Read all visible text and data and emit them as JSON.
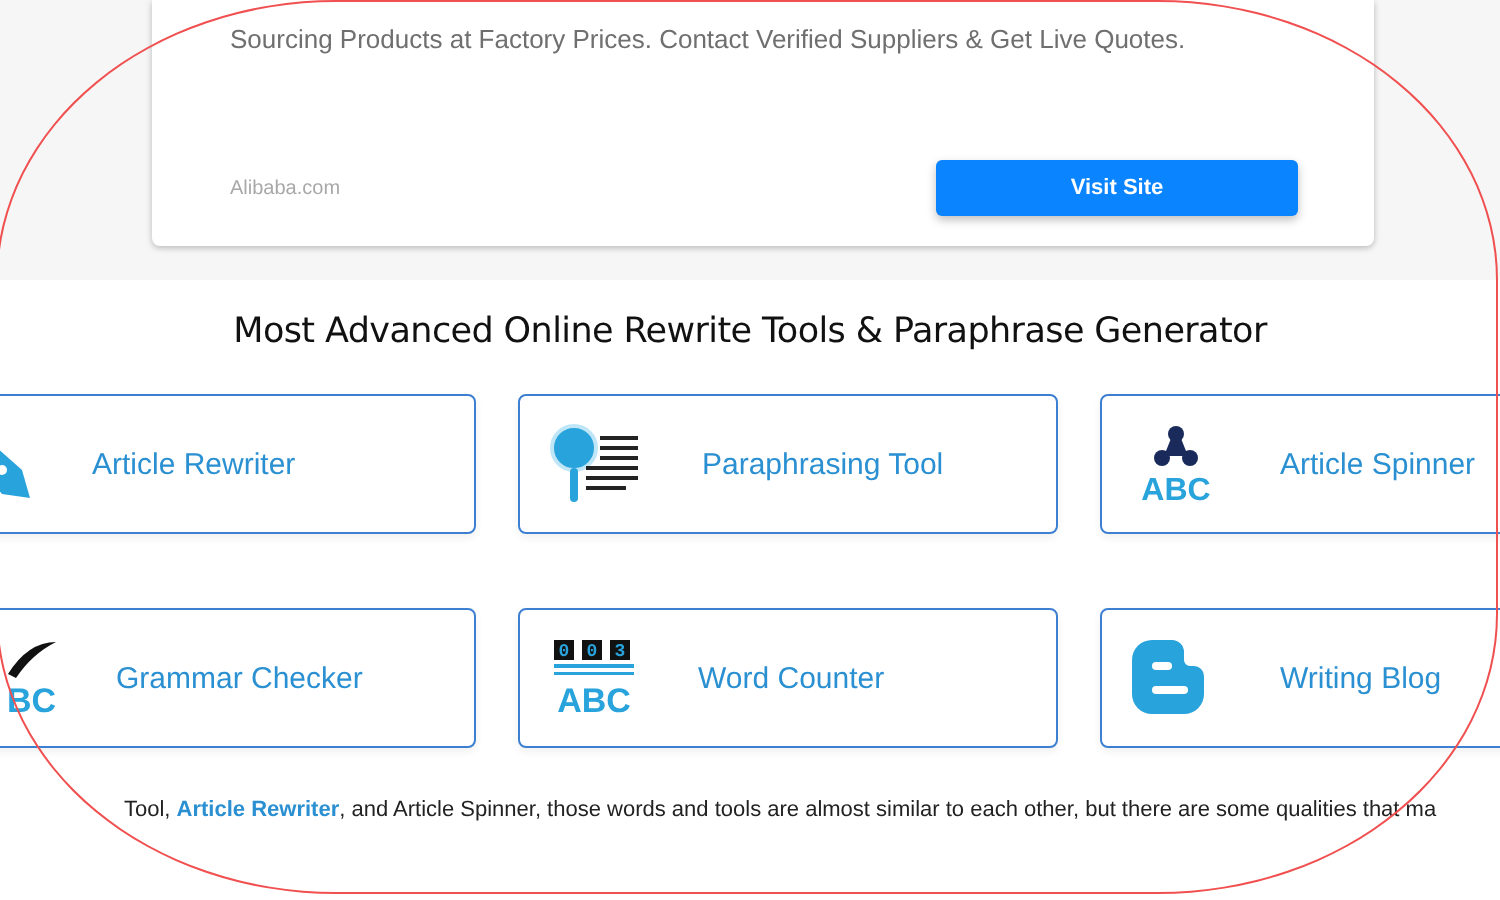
{
  "ad": {
    "description": "Sourcing Products at Factory Prices. Contact Verified Suppliers & Get Live Quotes.",
    "source": "Alibaba.com",
    "button": "Visit Site"
  },
  "heading": "Most Advanced Online Rewrite Tools & Paraphrase Generator",
  "tools": [
    {
      "label": "Article Rewriter",
      "kind": "pen"
    },
    {
      "label": "Paraphrasing Tool",
      "kind": "magnifier"
    },
    {
      "label": "Article Spinner",
      "kind": "spinner",
      "icon_text": "ABC"
    },
    {
      "label": "Grammar Checker",
      "kind": "quill",
      "icon_text": "BC"
    },
    {
      "label": "Word Counter",
      "kind": "counter",
      "icon_text": "ABC",
      "digits": [
        "0",
        "0",
        "3"
      ]
    },
    {
      "label": "Writing Blog",
      "kind": "blog"
    }
  ],
  "paragraph": {
    "before": "Tool, ",
    "link": "Article Rewriter",
    "after": ", and Article Spinner, those words and tools are almost similar to each other, but there are some qualities that ma"
  }
}
